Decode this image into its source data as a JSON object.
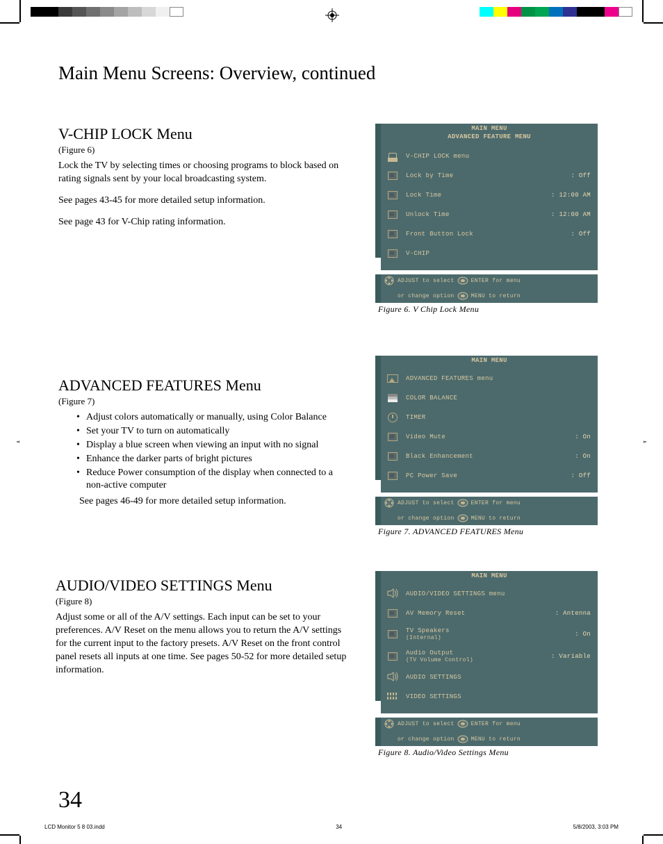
{
  "page_title": "Main Menu Screens: Overview, continued",
  "page_number": "34",
  "footer": {
    "file": "LCD Monitor 5 8 03.indd",
    "page": "34",
    "timestamp": "5/8/2003, 3:03 PM"
  },
  "sections": {
    "vchip": {
      "title": "V-CHIP LOCK Menu",
      "fig": "(Figure 6)",
      "p1": "Lock the TV by selecting times or choosing programs to block based on rating signals sent by your local broadcasting system.",
      "p2": "See pages 43-45 for more detailed setup information.",
      "p3": "See page 43 for V-Chip rating information."
    },
    "adv": {
      "title": "ADVANCED FEATURES Menu",
      "fig": "(Figure 7)",
      "bullets": [
        "Adjust colors automatically or manually, using Color Balance",
        "Set your TV to turn on automatically",
        "Display a blue screen when viewing an input with no signal",
        "Enhance the darker parts of bright pictures",
        "Reduce Power consumption of the display when connected to a non-active computer"
      ],
      "trail": "See pages 46-49 for more detailed setup information."
    },
    "av": {
      "title": "AUDIO/VIDEO SETTINGS Menu",
      "fig": "(Figure 8)",
      "p1": "Adjust some or all of the A/V settings.  Each input can be set to your preferences.  A/V Reset on the menu allows you to return the A/V settings for the current input to the factory presets.  A/V Reset on the front control panel resets all inputs at one time.  See pages 50-52 for more detailed setup information."
    }
  },
  "osd": {
    "hdr_main": "MAIN MENU",
    "help": {
      "adjust": "ADJUST to select",
      "enter": "ENTER for menu",
      "change": "or change option",
      "menu": "MENU  to return"
    },
    "fig6": {
      "hdr2": "ADVANCED FEATURE MENU",
      "caption": "Figure 6.  V Chip Lock Menu",
      "rows": [
        {
          "icon": "lock",
          "label": "V-CHIP LOCK menu",
          "value": ""
        },
        {
          "icon": "box",
          "label": "Lock by Time",
          "value": ": Off"
        },
        {
          "icon": "box",
          "label": "Lock Time",
          "value": ": 12:00 AM"
        },
        {
          "icon": "box",
          "label": "Unlock Time",
          "value": ": 12:00 AM"
        },
        {
          "icon": "box",
          "label": "Front Button Lock",
          "value": ": Off"
        },
        {
          "icon": "box",
          "label": "V-CHIP",
          "value": ""
        }
      ]
    },
    "fig7": {
      "caption": "Figure 7.  ADVANCED FEATURES Menu",
      "rows": [
        {
          "icon": "pict",
          "label": "ADVANCED FEATURES menu",
          "value": ""
        },
        {
          "icon": "bars",
          "label": "COLOR BALANCE",
          "value": ""
        },
        {
          "icon": "clock",
          "label": "TIMER",
          "value": ""
        },
        {
          "icon": "box",
          "label": "Video Mute",
          "value": ": On"
        },
        {
          "icon": "box",
          "label": "Black Enhancement",
          "value": ": On"
        },
        {
          "icon": "box",
          "label": "PC Power Save",
          "value": ": Off"
        }
      ]
    },
    "fig8": {
      "caption": "Figure 8.  Audio/Video Settings Menu",
      "rows": [
        {
          "icon": "speaker",
          "label": "AUDIO/VIDEO SETTINGS menu",
          "value": ""
        },
        {
          "icon": "box",
          "label": "AV Memory Reset",
          "value": ": Antenna"
        },
        {
          "icon": "box",
          "label": "TV Speakers",
          "sub": "(Internal)",
          "value": ": On"
        },
        {
          "icon": "box",
          "label": "Audio Output",
          "sub": "(TV Volume Control)",
          "value": ": Variable"
        },
        {
          "icon": "speaker",
          "label": "AUDIO SETTINGS",
          "value": ""
        },
        {
          "icon": "dots",
          "label": "VIDEO SETTINGS",
          "value": ""
        }
      ]
    }
  }
}
